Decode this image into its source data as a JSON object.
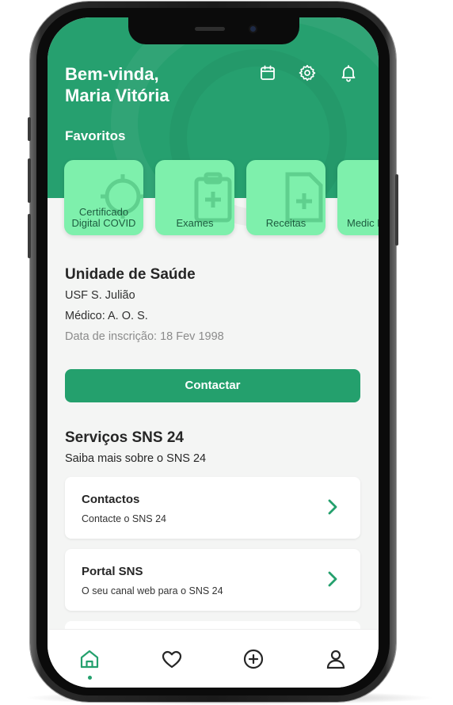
{
  "header": {
    "greeting_line1": "Bem-vinda,",
    "greeting_line2": "Maria Vitória",
    "icons": [
      "calendar-icon",
      "gear-icon",
      "bell-icon"
    ]
  },
  "favorites": {
    "title": "Favoritos",
    "items": [
      {
        "label": "Certificado Digital COVID",
        "icon": "shield-icon"
      },
      {
        "label": "Exames",
        "icon": "clipboard-icon"
      },
      {
        "label": "Receitas",
        "icon": "document-icon"
      },
      {
        "label": "Medic Habi",
        "icon": "pill-icon"
      }
    ]
  },
  "health_unit": {
    "title": "Unidade de Saúde",
    "name": "USF S. Julião",
    "doctor": "Médico: A. O. S.",
    "registration": "Data de inscrição: 18 Fev 1998",
    "contact_label": "Contactar"
  },
  "services": {
    "title": "Serviços SNS 24",
    "subtitle": "Saiba mais sobre o SNS 24",
    "items": [
      {
        "title": "Contactos",
        "subtitle": "Contacte o SNS 24"
      },
      {
        "title": "Portal SNS",
        "subtitle": "O seu canal web para o SNS 24"
      }
    ]
  },
  "bottom_nav": {
    "items": [
      "home-icon",
      "heart-icon",
      "plus-circle-icon",
      "user-icon"
    ],
    "active": "home-icon"
  },
  "colors": {
    "brand_green": "#26a06f",
    "card_green": "#7ef0ac",
    "card_text": "#1d5c3f",
    "background": "#f4f5f4"
  }
}
